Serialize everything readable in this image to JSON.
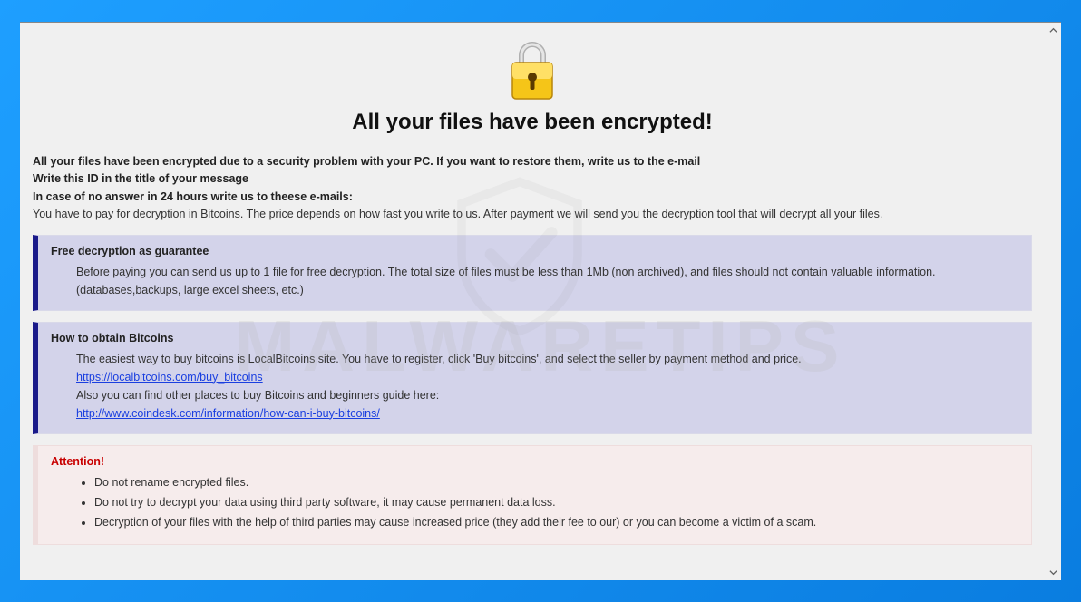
{
  "title": "All your files have been encrypted!",
  "intro": {
    "l1": "All your files have been encrypted due to a security problem with your PC. If you want to restore them, write us to the e-mail",
    "l2": "Write this ID in the title of your message",
    "l3": "In case of no answer in 24 hours write us to theese e-mails:",
    "l4": "You have to pay for decryption in Bitcoins. The price depends on how fast you write to us. After payment we will send you the decryption tool that will decrypt all your files."
  },
  "guarantee": {
    "title": "Free decryption as guarantee",
    "body": "Before paying you can send us up to 1 file for free decryption. The total size of files must be less than 1Mb (non archived), and files should not contain valuable information. (databases,backups, large excel sheets, etc.)"
  },
  "bitcoins": {
    "title": "How to obtain Bitcoins",
    "l1": "The easiest way to buy bitcoins is LocalBitcoins site. You have to register, click 'Buy bitcoins', and select the seller by payment method and price.",
    "link1": "https://localbitcoins.com/buy_bitcoins",
    "l2": "Also you can find other places to buy Bitcoins and beginners guide here:",
    "link2": "http://www.coindesk.com/information/how-can-i-buy-bitcoins/"
  },
  "attention": {
    "title": "Attention!",
    "items": [
      "Do not rename encrypted files.",
      "Do not try to decrypt your data using third party software, it may cause permanent data loss.",
      "Decryption of your files with the help of third parties may cause increased price (they add their fee to our) or you can become a victim of a scam."
    ]
  },
  "watermark": "MALWARETIPS"
}
